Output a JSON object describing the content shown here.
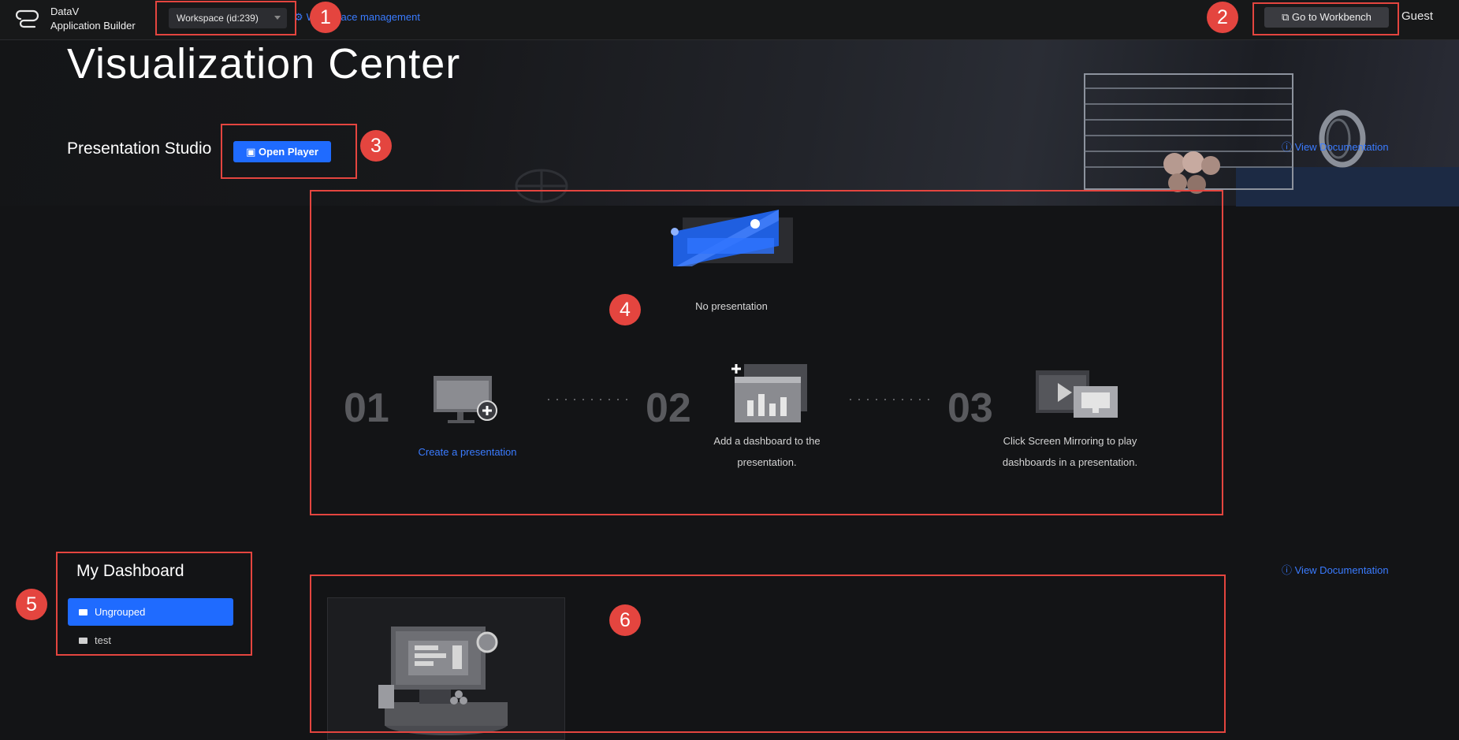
{
  "header": {
    "brand_line1": "DataV",
    "brand_line2": "Application Builder",
    "workspace_select": "Workspace (id:239)",
    "workspace_management": "Workspace management",
    "go_to_workbench": "Go to Workbench",
    "user": "Guest"
  },
  "page": {
    "title": "Visualization Center"
  },
  "presentation_studio": {
    "heading": "Presentation Studio",
    "open_player": "Open Player",
    "view_documentation": "View Documentation",
    "empty_text": "No presentation",
    "steps": [
      {
        "number": "01",
        "label": "Create a presentation"
      },
      {
        "number": "02",
        "label": "Add a dashboard to the presentation."
      },
      {
        "number": "03",
        "label": "Click Screen Mirroring to play dashboards in a presentation."
      }
    ]
  },
  "my_dashboard": {
    "heading": "My Dashboard",
    "view_documentation": "View Documentation",
    "groups": [
      {
        "label": "Ungrouped",
        "selected": true
      },
      {
        "label": "test",
        "selected": false
      }
    ]
  },
  "annotations": [
    "1",
    "2",
    "3",
    "4",
    "5",
    "6"
  ],
  "colors": {
    "accent_blue": "#1f6bff",
    "link_blue": "#3a7bff",
    "annotation_red": "#e4453f",
    "background": "#131416"
  }
}
